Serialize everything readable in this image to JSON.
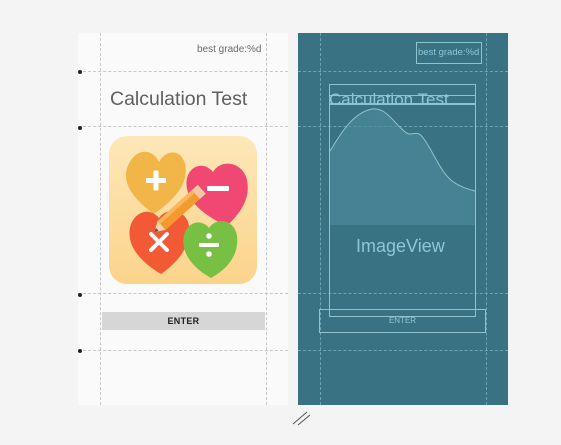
{
  "design": {
    "best_grade": "best grade:%d",
    "title": "Calculation Test",
    "enter_label": "ENTER",
    "image_icon": "math-operators-hearts-icon"
  },
  "blueprint": {
    "best_grade": "best grade:%d",
    "title": "Calculation Test",
    "image_label": "ImageView",
    "enter_label": "ENTER"
  },
  "colors": {
    "blueprint_bg": "#397383",
    "blueprint_line": "#8fc3d0",
    "design_bg": "#fafafa",
    "button_bg": "#d6d6d6"
  }
}
